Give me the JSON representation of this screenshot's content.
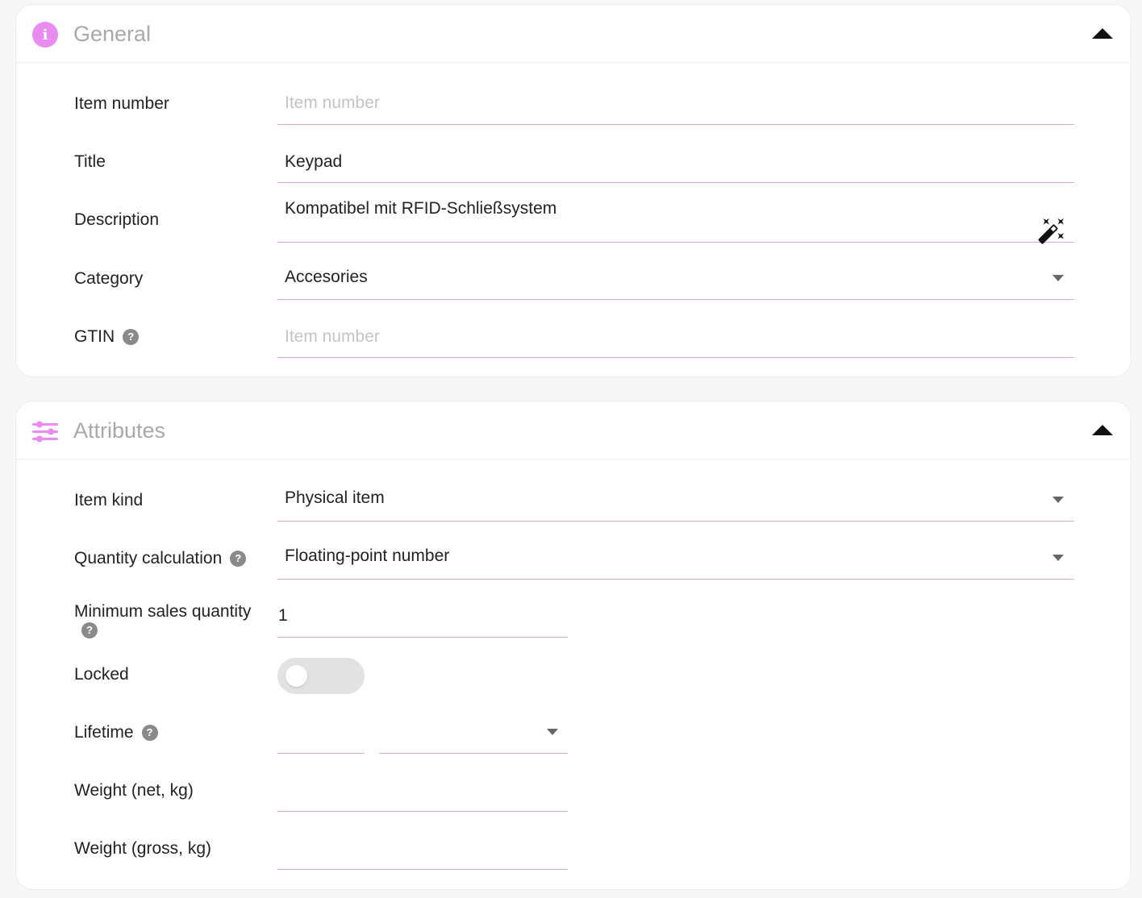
{
  "general": {
    "title": "General",
    "fields": {
      "item_number": {
        "label": "Item number",
        "value": "",
        "placeholder": "Item number"
      },
      "title": {
        "label": "Title",
        "value": "Keypad"
      },
      "description": {
        "label": "Description",
        "value": "Kompatibel mit RFID-Schließsystem"
      },
      "category": {
        "label": "Category",
        "value": "Accesories"
      },
      "gtin": {
        "label": "GTIN",
        "value": "",
        "placeholder": "Item number"
      }
    }
  },
  "attributes": {
    "title": "Attributes",
    "fields": {
      "item_kind": {
        "label": "Item kind",
        "value": "Physical item"
      },
      "quantity_calculation": {
        "label": "Quantity calculation",
        "value": "Floating-point number"
      },
      "minimum_sales_quantity": {
        "label": "Minimum sales quantity",
        "value": "1"
      },
      "locked": {
        "label": "Locked",
        "value": false
      },
      "lifetime": {
        "label": "Lifetime",
        "value": "",
        "unit": ""
      },
      "weight_net": {
        "label": "Weight (net, kg)",
        "value": ""
      },
      "weight_gross": {
        "label": "Weight (gross, kg)",
        "value": ""
      }
    }
  },
  "icons": {
    "general": "info-icon",
    "attributes": "sliders-icon",
    "collapse": "chevron-up-icon",
    "help": "question-icon",
    "ai": "magic-wand-icon"
  },
  "colors": {
    "accent": "#e98bf0",
    "underline": "#d9a9dc"
  }
}
